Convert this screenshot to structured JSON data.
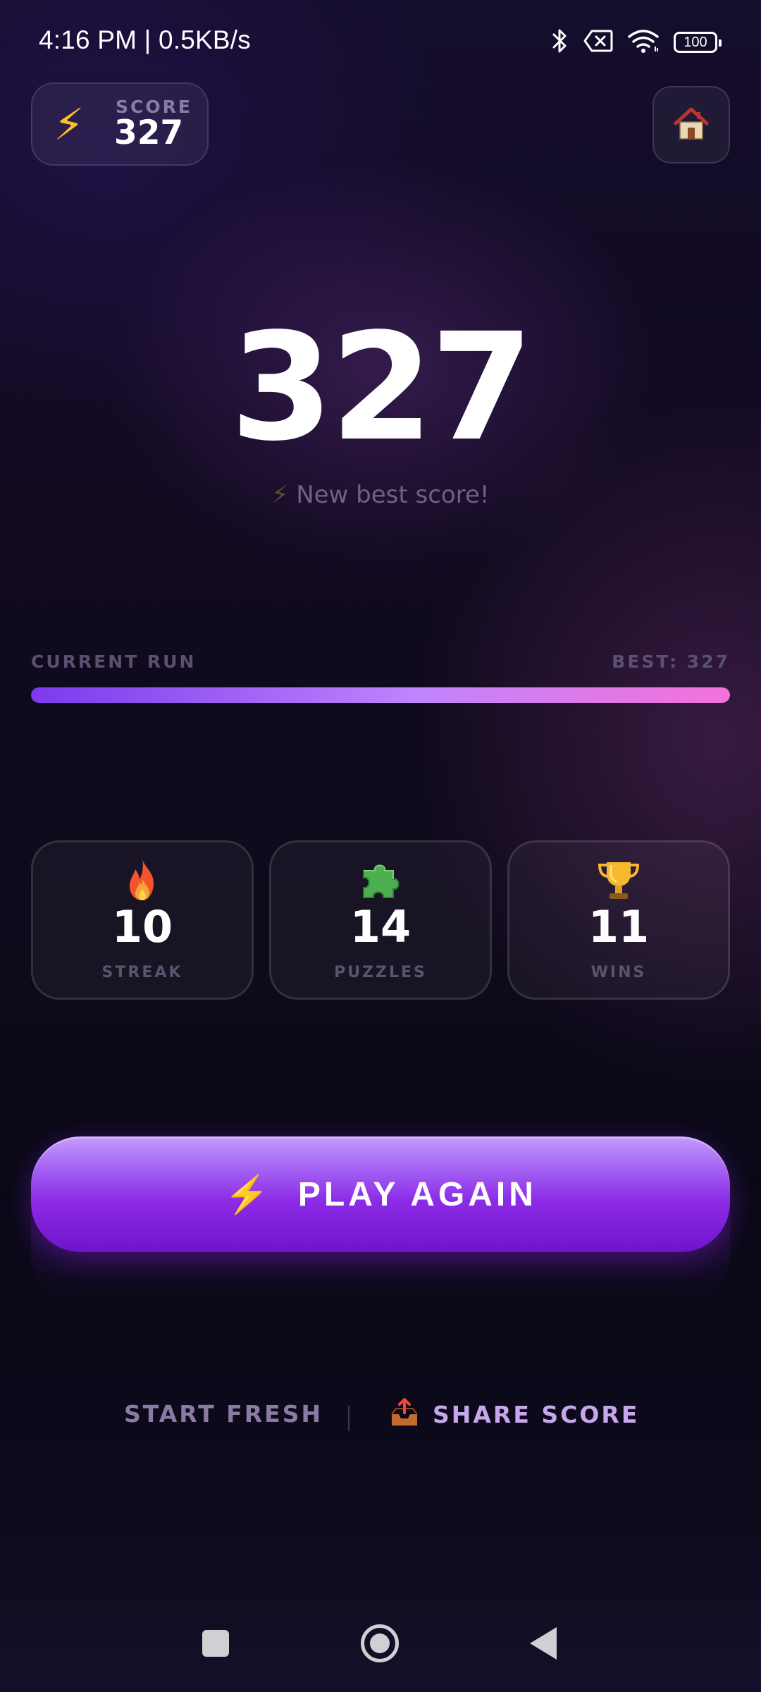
{
  "status_bar": {
    "time": "4:16 PM | 0.5KB/s",
    "battery": "100",
    "icons": [
      "bluetooth-icon",
      "sim-off-icon",
      "wifi-icon",
      "battery-icon"
    ]
  },
  "header": {
    "score_label": "SCORE",
    "score_value": "327",
    "score_icon": "lightning-icon",
    "home_icon": "house-icon"
  },
  "hero": {
    "score": "327",
    "best_message": "New best score!",
    "best_icon": "lightning-icon"
  },
  "progress": {
    "label": "CURRENT RUN",
    "best_text": "BEST: 327",
    "fraction": 1.0
  },
  "stats": [
    {
      "icon": "fire-icon",
      "value": "10",
      "label": "STREAK"
    },
    {
      "icon": "puzzle-icon",
      "value": "14",
      "label": "PUZZLES"
    },
    {
      "icon": "trophy-icon",
      "value": "11",
      "label": "WINS"
    }
  ],
  "actions": {
    "play_again": "PLAY AGAIN",
    "start_fresh": "START FRESH",
    "share_score": "SHARE SCORE",
    "share_icon": "outbox-tray-icon"
  },
  "colors": {
    "accent_purple": "#8d2ce8",
    "progress_start": "#7c3aed",
    "progress_end": "#f472d9",
    "bolt_yellow": "#f8c22b"
  }
}
